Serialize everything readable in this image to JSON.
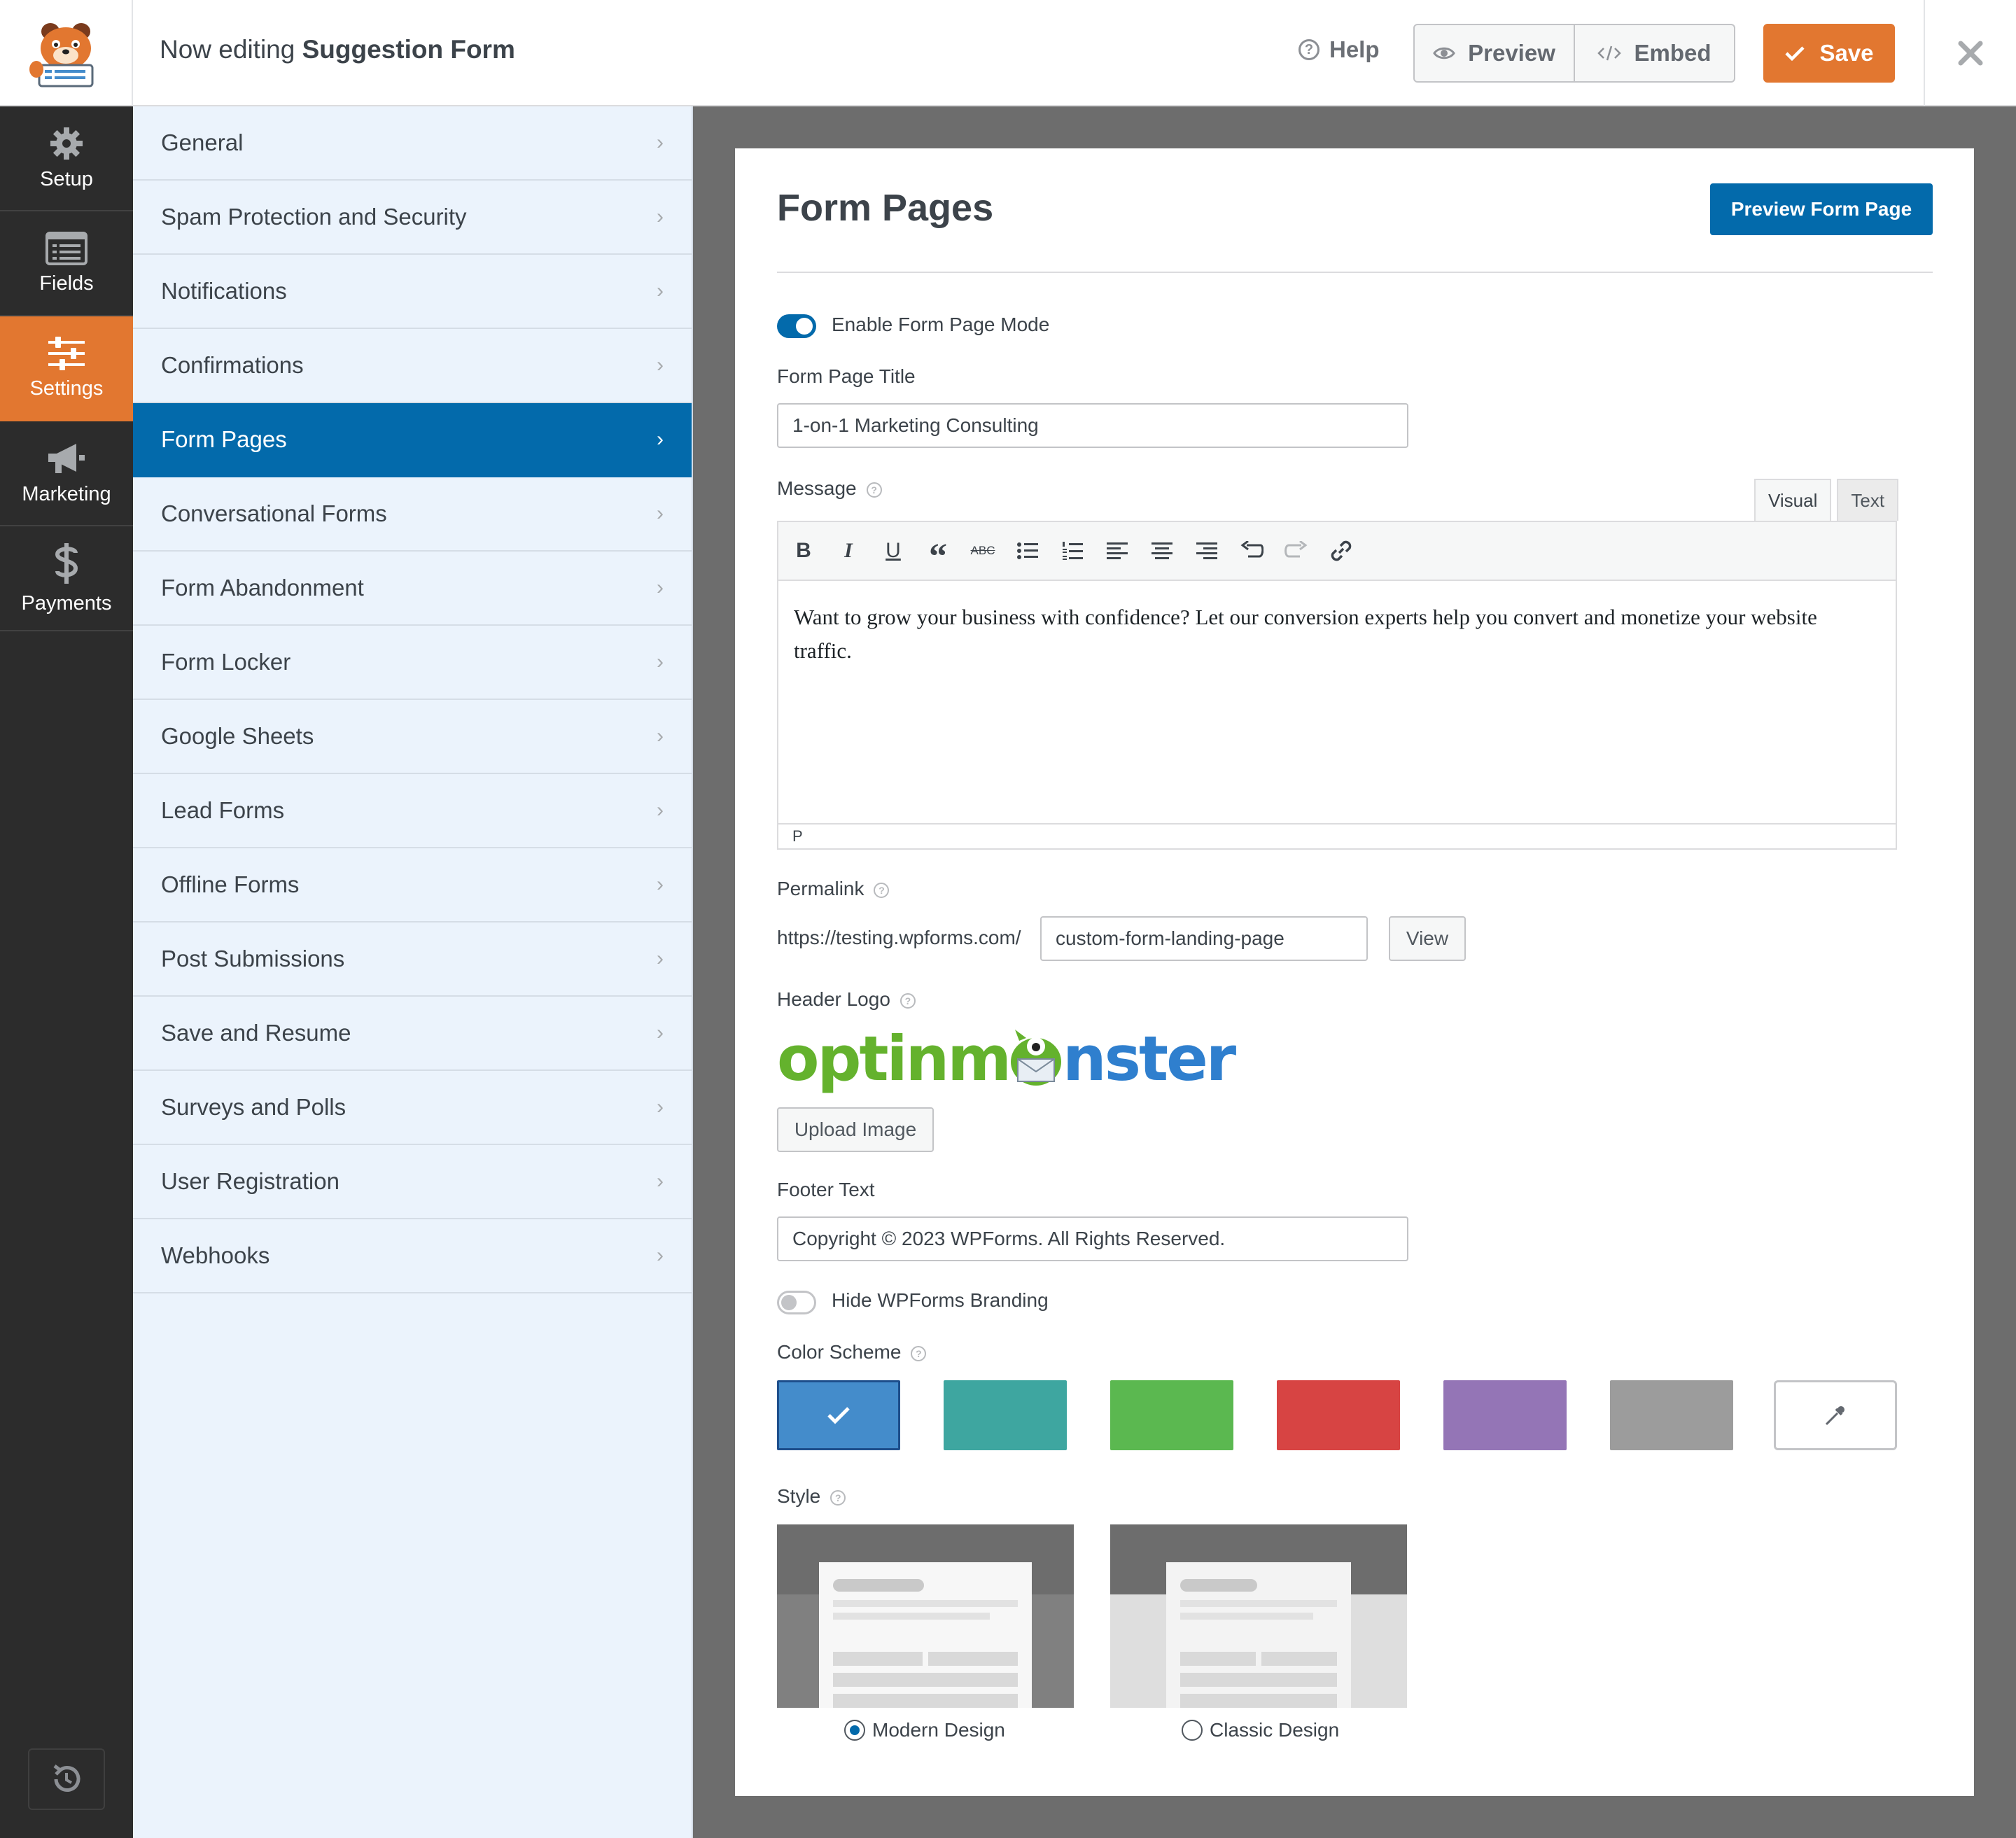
{
  "header": {
    "editing_prefix": "Now editing",
    "form_name": "Suggestion Form",
    "help_label": "Help",
    "preview_label": "Preview",
    "embed_label": "Embed",
    "save_label": "Save"
  },
  "rail": {
    "items": [
      {
        "label": "Setup",
        "icon": "gear-icon"
      },
      {
        "label": "Fields",
        "icon": "fields-icon"
      },
      {
        "label": "Settings",
        "icon": "sliders-icon",
        "active": true
      },
      {
        "label": "Marketing",
        "icon": "megaphone-icon"
      },
      {
        "label": "Payments",
        "icon": "dollar-icon"
      }
    ]
  },
  "settings_panel": {
    "items": [
      "General",
      "Spam Protection and Security",
      "Notifications",
      "Confirmations",
      "Form Pages",
      "Conversational Forms",
      "Form Abandonment",
      "Form Locker",
      "Google Sheets",
      "Lead Forms",
      "Offline Forms",
      "Post Submissions",
      "Save and Resume",
      "Surveys and Polls",
      "User Registration",
      "Webhooks"
    ],
    "active": "Form Pages"
  },
  "content": {
    "title": "Form Pages",
    "preview_button": "Preview Form Page",
    "enable_label": "Enable Form Page Mode",
    "enable_on": true,
    "page_title_label": "Form Page Title",
    "page_title_value": "1-on-1 Marketing Consulting",
    "message_label": "Message",
    "editor_tab_visual": "Visual",
    "editor_tab_text": "Text",
    "message_text": "Want to grow your business with confidence? Let our conversion experts help you convert and monetize your website traffic.",
    "editor_path": "P",
    "permalink_label": "Permalink",
    "permalink_base": "https://testing.wpforms.com/",
    "permalink_slug": "custom-form-landing-page",
    "view_button": "View",
    "header_logo_label": "Header Logo",
    "logo_text_left": "optinm",
    "logo_text_right": "nster",
    "upload_button": "Upload Image",
    "footer_label": "Footer Text",
    "footer_value": "Copyright © 2023 WPForms. All Rights Reserved.",
    "hide_branding_label": "Hide WPForms Branding",
    "hide_branding_on": false,
    "color_scheme_label": "Color Scheme",
    "colors": [
      "#448ccb",
      "#3ea6a0",
      "#5bb850",
      "#d74443",
      "#9475b6",
      "#9c9c9c"
    ],
    "selected_color": "#448ccb",
    "style_label": "Style",
    "style_modern": "Modern Design",
    "style_classic": "Classic Design",
    "selected_style": "Modern Design"
  },
  "colors": {
    "accent_orange": "#e27730",
    "accent_blue": "#036aab",
    "rail_bg": "#2c2c2c",
    "panel_bg": "#ebf3fc"
  }
}
